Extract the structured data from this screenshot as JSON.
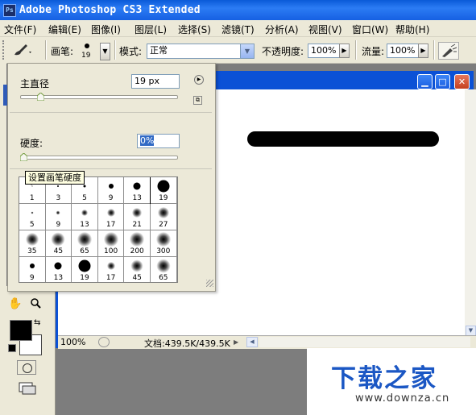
{
  "titlebar": {
    "app_title": "Adobe Photoshop CS3 Extended",
    "icon_text": "Ps"
  },
  "menu": [
    "文件(F)",
    "编辑(E)",
    "图像(I)",
    "图层(L)",
    "选择(S)",
    "滤镜(T)",
    "分析(A)",
    "视图(V)",
    "窗口(W)",
    "帮助(H)"
  ],
  "options": {
    "brush_label": "画笔:",
    "brush_size": "19",
    "mode_label": "模式:",
    "mode_value": "正常",
    "opacity_label": "不透明度:",
    "opacity_value": "100%",
    "flow_label": "流量:",
    "flow_value": "100%"
  },
  "brush_panel": {
    "diameter_label": "主直径",
    "diameter_value": "19 px",
    "diameter_fraction": 0.06,
    "hardness_label": "硬度:",
    "hardness_value": "0%",
    "hardness_fraction": 0.0,
    "tooltip": "设置画笔硬度",
    "presets": [
      {
        "size": "1",
        "kind": "hard",
        "d": 1
      },
      {
        "size": "3",
        "kind": "hard",
        "d": 2
      },
      {
        "size": "5",
        "kind": "hard",
        "d": 3
      },
      {
        "size": "9",
        "kind": "hard",
        "d": 6
      },
      {
        "size": "13",
        "kind": "hard",
        "d": 9
      },
      {
        "size": "19",
        "kind": "hard",
        "d": 15,
        "selected": true
      },
      {
        "size": "5",
        "kind": "soft",
        "d": 3
      },
      {
        "size": "9",
        "kind": "soft",
        "d": 5
      },
      {
        "size": "13",
        "kind": "soft",
        "d": 8
      },
      {
        "size": "17",
        "kind": "soft",
        "d": 10
      },
      {
        "size": "21",
        "kind": "soft",
        "d": 12
      },
      {
        "size": "27",
        "kind": "soft",
        "d": 14
      },
      {
        "size": "35",
        "kind": "soft",
        "d": 16
      },
      {
        "size": "45",
        "kind": "soft",
        "d": 17
      },
      {
        "size": "65",
        "kind": "soft",
        "d": 18
      },
      {
        "size": "100",
        "kind": "soft",
        "d": 18
      },
      {
        "size": "200",
        "kind": "soft",
        "d": 18
      },
      {
        "size": "300",
        "kind": "soft",
        "d": 18
      },
      {
        "size": "9",
        "kind": "hard",
        "d": 6
      },
      {
        "size": "13",
        "kind": "hard",
        "d": 9
      },
      {
        "size": "19",
        "kind": "hard",
        "d": 15
      },
      {
        "size": "17",
        "kind": "soft",
        "d": 10
      },
      {
        "size": "45",
        "kind": "soft",
        "d": 15
      },
      {
        "size": "65",
        "kind": "soft",
        "d": 17
      }
    ]
  },
  "document": {
    "zoom": "100%",
    "doc_info": "文档:439.5K/439.5K"
  },
  "watermark": {
    "brand": "下载之家",
    "url": "www.downza.cn"
  },
  "colors": {
    "titlebar": "#0a5ad8",
    "chrome": "#ece9d8",
    "foreground": "#000000",
    "background": "#ffffff",
    "watermark_blue": "#1b57c4"
  }
}
